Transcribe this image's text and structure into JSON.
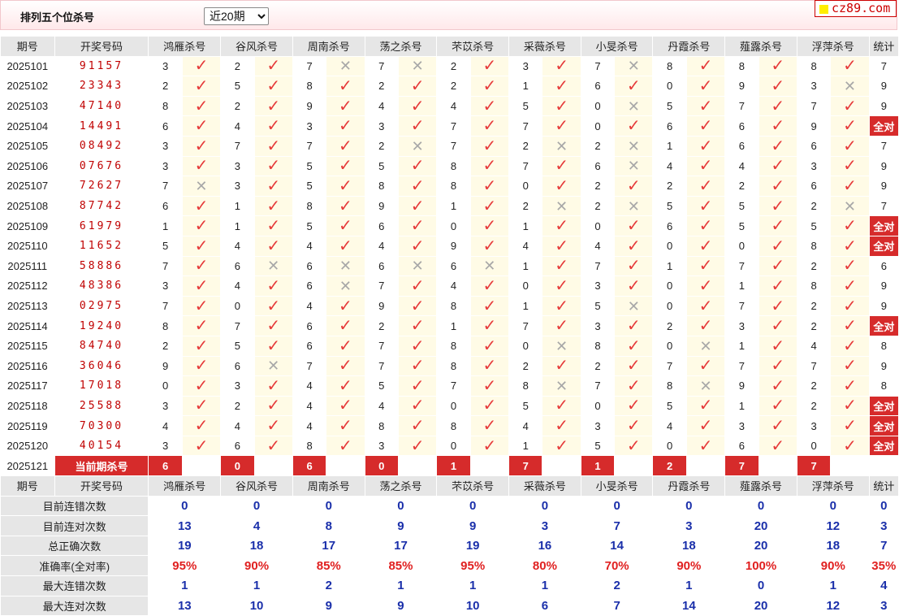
{
  "header": {
    "title": "排列五个位杀号",
    "range_selected": "近20期",
    "logo_text": "cz89.com"
  },
  "columns": {
    "period": "期号",
    "draw": "开奖号码",
    "experts": [
      "鸿雁杀号",
      "谷风杀号",
      "周南杀号",
      "荡之杀号",
      "芣苡杀号",
      "采薇杀号",
      "小旻杀号",
      "丹霞杀号",
      "薤露杀号",
      "浮萍杀号"
    ],
    "stat": "统计"
  },
  "rows": [
    {
      "period": "2025101",
      "draw": "91157",
      "kills": [
        "3",
        "2",
        "7",
        "7",
        "2",
        "3",
        "7",
        "8",
        "8",
        "8"
      ],
      "ok": [
        1,
        1,
        0,
        0,
        1,
        1,
        0,
        1,
        1,
        1
      ],
      "stat": "7"
    },
    {
      "period": "2025102",
      "draw": "23343",
      "kills": [
        "2",
        "5",
        "8",
        "2",
        "2",
        "1",
        "6",
        "0",
        "9",
        "3"
      ],
      "ok": [
        1,
        1,
        1,
        1,
        1,
        1,
        1,
        1,
        1,
        0
      ],
      "stat": "9"
    },
    {
      "period": "2025103",
      "draw": "47140",
      "kills": [
        "8",
        "2",
        "9",
        "4",
        "4",
        "5",
        "0",
        "5",
        "7",
        "7"
      ],
      "ok": [
        1,
        1,
        1,
        1,
        1,
        1,
        0,
        1,
        1,
        1
      ],
      "stat": "9"
    },
    {
      "period": "2025104",
      "draw": "14491",
      "kills": [
        "6",
        "4",
        "3",
        "3",
        "7",
        "7",
        "0",
        "6",
        "6",
        "9"
      ],
      "ok": [
        1,
        1,
        1,
        1,
        1,
        1,
        1,
        1,
        1,
        1
      ],
      "stat": "全对"
    },
    {
      "period": "2025105",
      "draw": "08492",
      "kills": [
        "3",
        "7",
        "7",
        "2",
        "7",
        "2",
        "2",
        "1",
        "6",
        "6"
      ],
      "ok": [
        1,
        1,
        1,
        0,
        1,
        0,
        0,
        1,
        1,
        1
      ],
      "stat": "7"
    },
    {
      "period": "2025106",
      "draw": "07676",
      "kills": [
        "3",
        "3",
        "5",
        "5",
        "8",
        "7",
        "6",
        "4",
        "4",
        "3"
      ],
      "ok": [
        1,
        1,
        1,
        1,
        1,
        1,
        0,
        1,
        1,
        1
      ],
      "stat": "9"
    },
    {
      "period": "2025107",
      "draw": "72627",
      "kills": [
        "7",
        "3",
        "5",
        "8",
        "8",
        "0",
        "2",
        "2",
        "2",
        "6"
      ],
      "ok": [
        0,
        1,
        1,
        1,
        1,
        1,
        1,
        1,
        1,
        1
      ],
      "stat": "9"
    },
    {
      "period": "2025108",
      "draw": "87742",
      "kills": [
        "6",
        "1",
        "8",
        "9",
        "1",
        "2",
        "2",
        "5",
        "5",
        "2"
      ],
      "ok": [
        1,
        1,
        1,
        1,
        1,
        0,
        0,
        1,
        1,
        0
      ],
      "stat": "7"
    },
    {
      "period": "2025109",
      "draw": "61979",
      "kills": [
        "1",
        "1",
        "5",
        "6",
        "0",
        "1",
        "0",
        "6",
        "5",
        "5"
      ],
      "ok": [
        1,
        1,
        1,
        1,
        1,
        1,
        1,
        1,
        1,
        1
      ],
      "stat": "全对"
    },
    {
      "period": "2025110",
      "draw": "11652",
      "kills": [
        "5",
        "4",
        "4",
        "4",
        "9",
        "4",
        "4",
        "0",
        "0",
        "8"
      ],
      "ok": [
        1,
        1,
        1,
        1,
        1,
        1,
        1,
        1,
        1,
        1
      ],
      "stat": "全对"
    },
    {
      "period": "2025111",
      "draw": "58886",
      "kills": [
        "7",
        "6",
        "6",
        "6",
        "6",
        "1",
        "7",
        "1",
        "7",
        "2"
      ],
      "ok": [
        1,
        0,
        0,
        0,
        0,
        1,
        1,
        1,
        1,
        1
      ],
      "stat": "6"
    },
    {
      "period": "2025112",
      "draw": "48386",
      "kills": [
        "3",
        "4",
        "6",
        "7",
        "4",
        "0",
        "3",
        "0",
        "1",
        "8"
      ],
      "ok": [
        1,
        1,
        0,
        1,
        1,
        1,
        1,
        1,
        1,
        1
      ],
      "stat": "9"
    },
    {
      "period": "2025113",
      "draw": "02975",
      "kills": [
        "7",
        "0",
        "4",
        "9",
        "8",
        "1",
        "5",
        "0",
        "7",
        "2"
      ],
      "ok": [
        1,
        1,
        1,
        1,
        1,
        1,
        0,
        1,
        1,
        1
      ],
      "stat": "9"
    },
    {
      "period": "2025114",
      "draw": "19240",
      "kills": [
        "8",
        "7",
        "6",
        "2",
        "1",
        "7",
        "3",
        "2",
        "3",
        "2"
      ],
      "ok": [
        1,
        1,
        1,
        1,
        1,
        1,
        1,
        1,
        1,
        1
      ],
      "stat": "全对"
    },
    {
      "period": "2025115",
      "draw": "84740",
      "kills": [
        "2",
        "5",
        "6",
        "7",
        "8",
        "0",
        "8",
        "0",
        "1",
        "4"
      ],
      "ok": [
        1,
        1,
        1,
        1,
        1,
        0,
        1,
        0,
        1,
        1
      ],
      "stat": "8"
    },
    {
      "period": "2025116",
      "draw": "36046",
      "kills": [
        "9",
        "6",
        "7",
        "7",
        "8",
        "2",
        "2",
        "7",
        "7",
        "7"
      ],
      "ok": [
        1,
        0,
        1,
        1,
        1,
        1,
        1,
        1,
        1,
        1
      ],
      "stat": "9"
    },
    {
      "period": "2025117",
      "draw": "17018",
      "kills": [
        "0",
        "3",
        "4",
        "5",
        "7",
        "8",
        "7",
        "8",
        "9",
        "2"
      ],
      "ok": [
        1,
        1,
        1,
        1,
        1,
        0,
        1,
        0,
        1,
        1
      ],
      "stat": "8"
    },
    {
      "period": "2025118",
      "draw": "25588",
      "kills": [
        "3",
        "2",
        "4",
        "4",
        "0",
        "5",
        "0",
        "5",
        "1",
        "2"
      ],
      "ok": [
        1,
        1,
        1,
        1,
        1,
        1,
        1,
        1,
        1,
        1
      ],
      "stat": "全对"
    },
    {
      "period": "2025119",
      "draw": "70300",
      "kills": [
        "4",
        "4",
        "4",
        "8",
        "8",
        "4",
        "3",
        "4",
        "3",
        "3"
      ],
      "ok": [
        1,
        1,
        1,
        1,
        1,
        1,
        1,
        1,
        1,
        1
      ],
      "stat": "全对"
    },
    {
      "period": "2025120",
      "draw": "40154",
      "kills": [
        "3",
        "6",
        "8",
        "3",
        "0",
        "1",
        "5",
        "0",
        "6",
        "0"
      ],
      "ok": [
        1,
        1,
        1,
        1,
        1,
        1,
        1,
        1,
        1,
        1
      ],
      "stat": "全对"
    }
  ],
  "current": {
    "period": "2025121",
    "label": "当前期杀号",
    "kills": [
      "6",
      "0",
      "6",
      "0",
      "1",
      "7",
      "1",
      "2",
      "7",
      "7"
    ]
  },
  "marks": {
    "ok": "✓",
    "no": "✕"
  },
  "stats": [
    {
      "label": "目前连错次数",
      "values": [
        "0",
        "0",
        "0",
        "0",
        "0",
        "0",
        "0",
        "0",
        "0",
        "0"
      ],
      "total": "0",
      "red": false
    },
    {
      "label": "目前连对次数",
      "values": [
        "13",
        "4",
        "8",
        "9",
        "9",
        "3",
        "7",
        "3",
        "20",
        "12"
      ],
      "total": "3",
      "red": false
    },
    {
      "label": "总正确次数",
      "values": [
        "19",
        "18",
        "17",
        "17",
        "19",
        "16",
        "14",
        "18",
        "20",
        "18"
      ],
      "total": "7",
      "red": false
    },
    {
      "label": "准确率(全对率)",
      "values": [
        "95%",
        "90%",
        "85%",
        "85%",
        "95%",
        "80%",
        "70%",
        "90%",
        "100%",
        "90%"
      ],
      "total": "35%",
      "red": true
    },
    {
      "label": "最大连错次数",
      "values": [
        "1",
        "1",
        "2",
        "1",
        "1",
        "1",
        "2",
        "1",
        "0",
        "1"
      ],
      "total": "4",
      "red": false
    },
    {
      "label": "最大连对次数",
      "values": [
        "13",
        "10",
        "9",
        "9",
        "10",
        "6",
        "7",
        "14",
        "20",
        "12"
      ],
      "total": "3",
      "red": false
    }
  ],
  "colors": {
    "accent_red": "#d62b2b",
    "check_red": "#e63a3a",
    "cross_gray": "#a8a8a8",
    "mark_bg": "#fffbe6",
    "stat_blue": "#1a2faa"
  }
}
